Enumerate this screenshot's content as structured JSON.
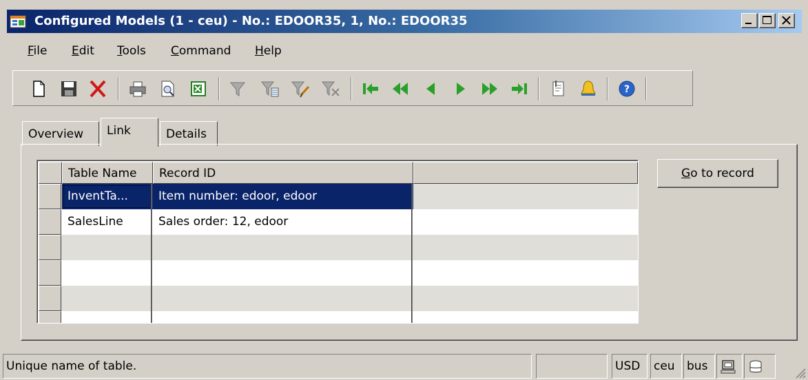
{
  "window": {
    "title": "Configured Models (1 - ceu) - No.: EDOOR35, 1, No.: EDOOR35",
    "icon": "app-form-icon",
    "controls": [
      "minimize",
      "maximize",
      "close"
    ]
  },
  "menu": [
    {
      "label": "File",
      "mnemonic": "F",
      "rest": "ile"
    },
    {
      "label": "Edit",
      "mnemonic": "E",
      "rest": "dit"
    },
    {
      "label": "Tools",
      "mnemonic": "T",
      "rest": "ools"
    },
    {
      "label": "Command",
      "mnemonic": "C",
      "rest": "ommand"
    },
    {
      "label": "Help",
      "mnemonic": "H",
      "rest": "elp"
    }
  ],
  "toolbar": {
    "buttons": [
      "new-icon",
      "save-icon",
      "delete-icon",
      "print-icon",
      "print-preview-icon",
      "export-excel-icon",
      "filter-icon",
      "filter-by-selection-icon",
      "advanced-filter-icon",
      "remove-filter-icon",
      "first-record-icon",
      "previous-page-icon",
      "previous-record-icon",
      "next-record-icon",
      "next-page-icon",
      "last-record-icon",
      "attachments-icon",
      "alert-icon",
      "help-icon"
    ]
  },
  "tabs": [
    {
      "label": "Overview",
      "active": false
    },
    {
      "label": "Link",
      "active": true
    },
    {
      "label": "Details",
      "active": false
    }
  ],
  "grid": {
    "columns": [
      "Table Name",
      "Record ID",
      ""
    ],
    "rows": [
      {
        "table_name": "InventTa...",
        "record_id": "Item number: edoor, edoor",
        "selected": true
      },
      {
        "table_name": "SalesLine",
        "record_id": "Sales order: 12, edoor",
        "selected": false
      },
      {
        "table_name": "",
        "record_id": "",
        "selected": false
      },
      {
        "table_name": "",
        "record_id": "",
        "selected": false
      },
      {
        "table_name": "",
        "record_id": "",
        "selected": false
      },
      {
        "table_name": "",
        "record_id": "",
        "selected": false
      }
    ]
  },
  "actions": {
    "goto_label_mnemonic": "G",
    "goto_label_rest": "o to record"
  },
  "status": {
    "message": "Unique name of table.",
    "currency": "USD",
    "company": "ceu",
    "layer": "bus",
    "icons": [
      "online-users-icon",
      "database-icon"
    ]
  },
  "colors": {
    "title_gradient_start": "#0a246a",
    "title_gradient_end": "#a6caf0",
    "selection": "#0a246a",
    "face": "#d4d0c8"
  }
}
